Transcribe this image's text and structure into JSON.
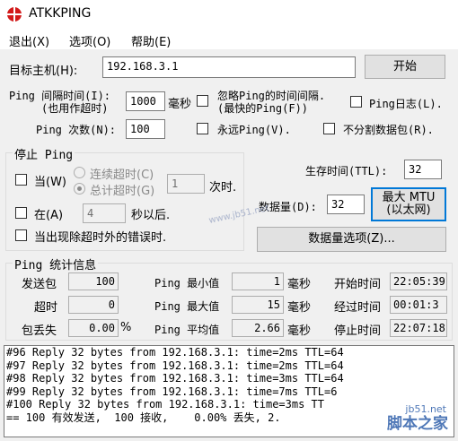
{
  "window": {
    "title": "ATKKPING"
  },
  "menu": [
    "退出(X)",
    "选项(O)",
    "帮助(E)"
  ],
  "target": {
    "label": "目标主机(H):",
    "value": "192.168.3.1",
    "start_button": "开始"
  },
  "interval": {
    "label_line1": "Ping 间隔时间(I):",
    "label_line2": "(也用作超时)",
    "value": "1000",
    "unit": "毫秒",
    "ignore_label_line1": "忽略Ping的时间间隔.",
    "ignore_label_line2": "(最快的Ping(F))",
    "log_label": "Ping日志(L)."
  },
  "count": {
    "label": "Ping 次数(N):",
    "value": "100",
    "forever_label": "永远Ping(V).",
    "nofrag_label": "不分割数据包(R)."
  },
  "stop": {
    "title": "停止 Ping",
    "when_label": "当(W)",
    "opt_consecutive": "连续超时(C)",
    "opt_total": "总计超时(G)",
    "timeout_value": "1",
    "timeout_unit": "次时.",
    "at_label": "在(A)",
    "at_value": "4",
    "at_unit": "秒以后.",
    "error_label": "当出现除超时外的错误时."
  },
  "ttl": {
    "label": "生存时间(TTL):",
    "value": "32"
  },
  "size": {
    "label": "数据量(D):",
    "value": "32",
    "mtu_line1": "最大 MTU",
    "mtu_line2": "(以太网)",
    "options_button": "数据量选项(Z)..."
  },
  "stats": {
    "title": "Ping  统计信息",
    "sent_label": "发送包",
    "sent_value": "100",
    "timeout_label": "超时",
    "timeout_value": "0",
    "loss_label": "包丢失",
    "loss_value": "0.00",
    "loss_unit": "%",
    "min_label": "Ping 最小值",
    "min_value": "1",
    "min_unit": "毫秒",
    "max_label": "Ping 最大值",
    "max_value": "15",
    "max_unit": "毫秒",
    "avg_label": "Ping 平均值",
    "avg_value": "2.66",
    "avg_unit": "毫秒",
    "start_label": "开始时间",
    "start_value": "22:05:39",
    "elapsed_label": "经过时间",
    "elapsed_value": "00:01:3",
    "stop_label": "停止时间",
    "stop_value": "22:07:18"
  },
  "log": [
    "#96 Reply 32 bytes from 192.168.3.1: time=2ms TTL=64",
    "#97 Reply 32 bytes from 192.168.3.1: time=2ms TTL=64",
    "#98 Reply 32 bytes from 192.168.3.1: time=3ms TTL=64",
    "#99 Reply 32 bytes from 192.168.3.1: time=7ms TTL=6",
    "#100 Reply 32 bytes from 192.168.3.1: time=3ms TT",
    "== 100 有效发送,  100 接收,    0.00% 丢失, 2."
  ],
  "watermark": {
    "mid": "www.jb51.net",
    "url": "jb51.net",
    "logo": "脚本之家"
  }
}
